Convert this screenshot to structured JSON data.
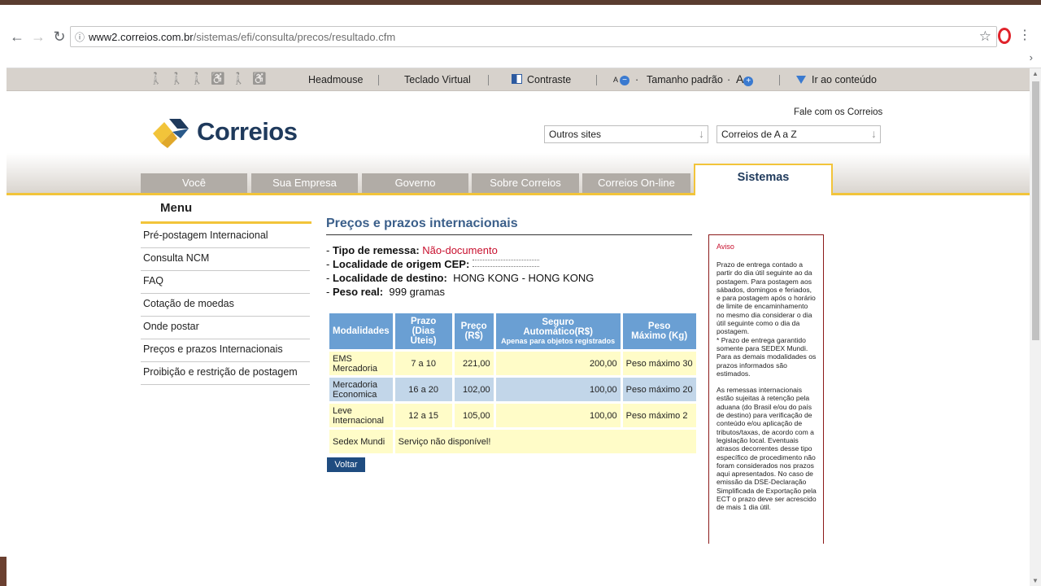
{
  "browser": {
    "url_host": "www2.correios.com.br",
    "url_path": "/sistemas/efi/consulta/precos/resultado.cfm"
  },
  "accessibility": {
    "headmouse": "Headmouse",
    "teclado": "Teclado Virtual",
    "contraste": "Contraste",
    "font_small": "A",
    "font_dot": "·",
    "tamanho": "Tamanho padrão",
    "font_large": "A",
    "ir_conteudo": "Ir ao conteúdo"
  },
  "header": {
    "logo_text": "Correios",
    "fale": "Fale com os Correios",
    "outros_sites": "Outros sites",
    "correios_az": "Correios de A a Z"
  },
  "tabs": [
    "Você",
    "Sua Empresa",
    "Governo",
    "Sobre Correios",
    "Correios On-line"
  ],
  "active_tab": "Sistemas",
  "menu": {
    "title": "Menu",
    "items": [
      "Pré-postagem Internacional",
      "Consulta NCM",
      "FAQ",
      "Cotação de moedas",
      "Onde postar",
      "Preços e prazos Internacionais",
      "Proibição e restrição de postagem"
    ]
  },
  "content": {
    "title": "Preços e prazos internacionais",
    "tipo_label": "Tipo de remessa:",
    "tipo_value": "Não-documento",
    "origem_label": "Localidade de origem CEP:",
    "destino_label": "Localidade de destino:",
    "destino_value": "HONG KONG - HONG KONG",
    "peso_label": "Peso real:",
    "peso_value": "999 gramas",
    "prefix": "-"
  },
  "table": {
    "headers": {
      "modalidades": "Modalidades",
      "prazo": "Prazo",
      "prazo_sub": "(Dias Úteis)",
      "preco": "Preço",
      "preco_sub": "(R$)",
      "seguro": "Seguro",
      "seguro_sub": "Automático(R$)",
      "seguro_note": "Apenas para objetos registrados",
      "peso": "Peso",
      "peso_sub": "Máximo (Kg)"
    },
    "rows": [
      {
        "mod1": "EMS",
        "mod2": "Mercadoria",
        "prazo": "7 a 10",
        "preco": "221,00",
        "seguro": "200,00",
        "peso": "Peso máximo 30"
      },
      {
        "mod1": "Mercadoria",
        "mod2": "Economica",
        "prazo": "16 a 20",
        "preco": "102,00",
        "seguro": "100,00",
        "peso": "Peso máximo 20"
      },
      {
        "mod1": "Leve",
        "mod2": "Internacional",
        "prazo": "12 a 15",
        "preco": "105,00",
        "seguro": "100,00",
        "peso": "Peso máximo 2"
      }
    ],
    "sedex": {
      "mod": "Sedex Mundi",
      "msg": "Serviço não disponível!"
    }
  },
  "voltar": "Voltar",
  "aviso": {
    "title": "Aviso",
    "p1": "Prazo de entrega contado a partir do dia útil seguinte ao da postagem. Para postagem aos sábados, domingos e feriados, e para postagem após o horário de limite de encaminhamento no mesmo dia considerar o dia útil seguinte como o dia da postagem.",
    "p2": "* Prazo de entrega garantido somente para SEDEX Mundi. Para as demais modalidades os prazos informados são estimados.",
    "p3": "As remessas internacionais estão sujeitas à retenção pela aduana (do Brasil e/ou do país de destino) para verificação de conteúdo e/ou aplicação de tributos/taxas, de acordo com a legislação local. Eventuais atrasos decorrentes desse tipo específico de procedimento não foram considerados nos prazos aqui apresentados. No caso de emissão da DSE-Declaração Simplificada de Exportação pela ECT o prazo deve ser acrescido de mais 1 dia útil."
  },
  "colors": {
    "brand_blue": "#1f3a5c",
    "brand_yellow": "#f2c43a",
    "header_blue": "#6a9fd3",
    "alert_red": "#c8102e"
  }
}
